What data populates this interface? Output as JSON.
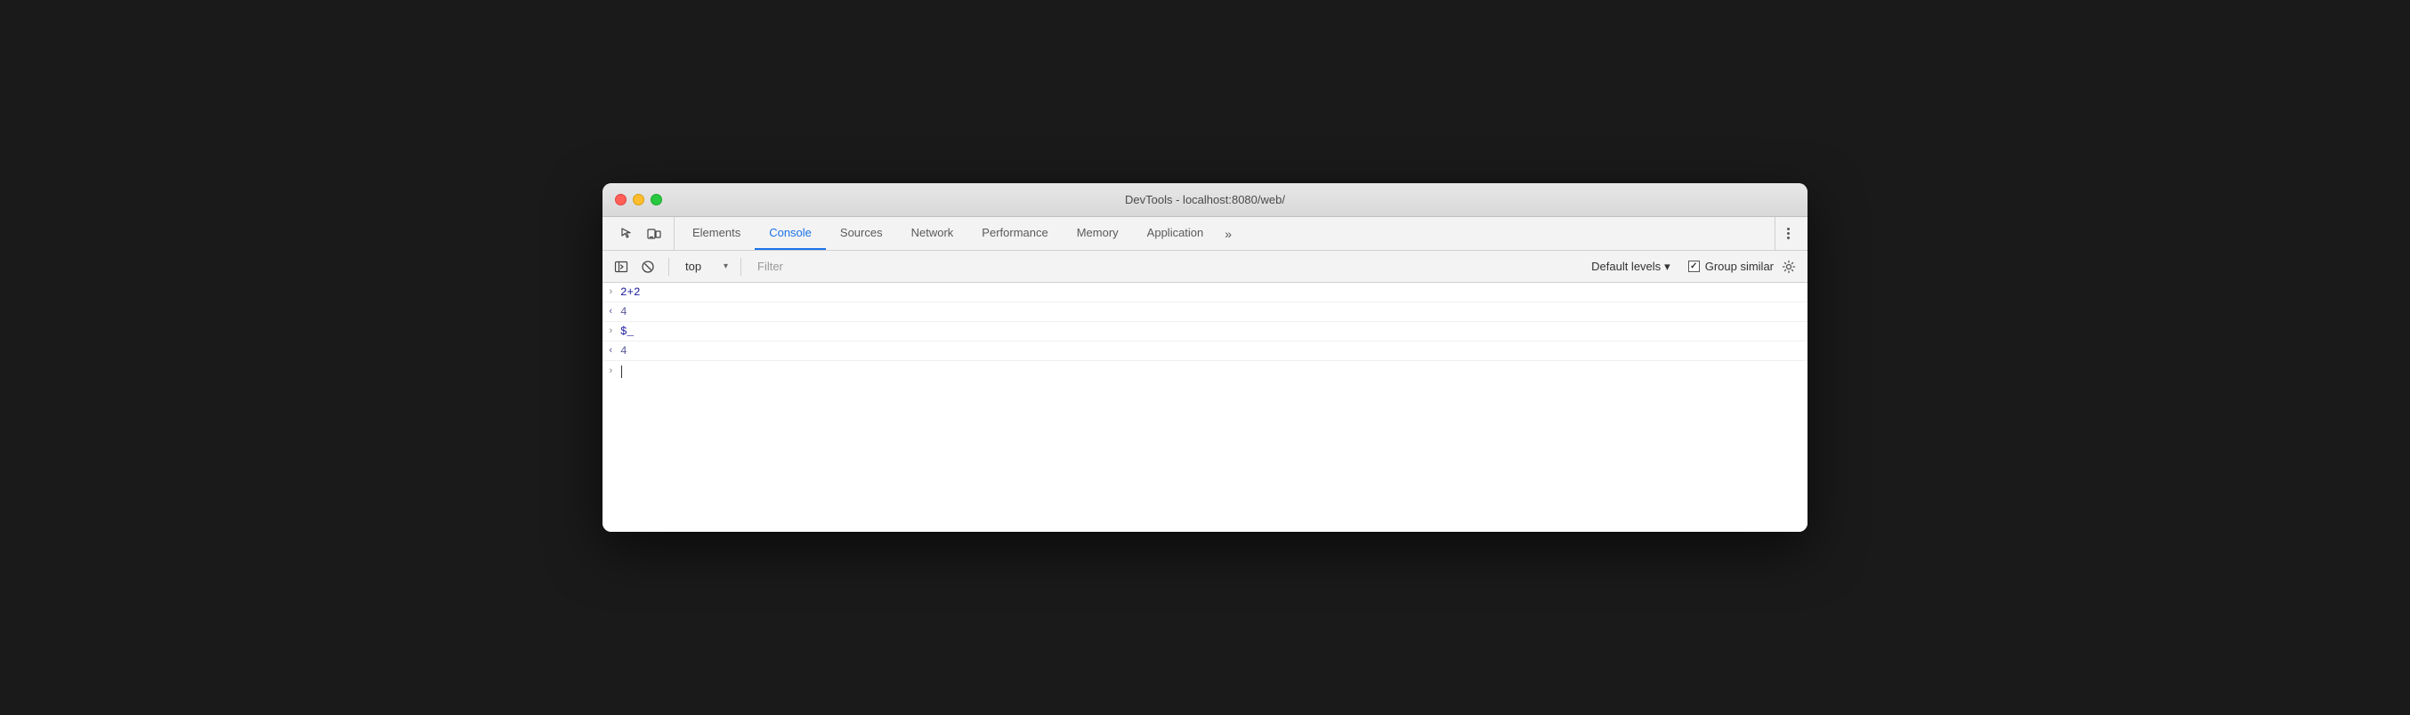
{
  "window": {
    "title": "DevTools - localhost:8080/web/"
  },
  "toolbar": {
    "elements_label": "Elements",
    "console_label": "Console",
    "sources_label": "Sources",
    "network_label": "Network",
    "performance_label": "Performance",
    "memory_label": "Memory",
    "application_label": "Application",
    "overflow_label": "»"
  },
  "console_toolbar": {
    "context_value": "top",
    "context_placeholder": "top",
    "filter_placeholder": "Filter",
    "default_levels_label": "Default levels",
    "group_similar_label": "Group similar"
  },
  "console_rows": [
    {
      "chevron": ">",
      "type": "input",
      "text": "2+2"
    },
    {
      "chevron": "<",
      "type": "output",
      "text": "4"
    },
    {
      "chevron": ">",
      "type": "input",
      "text": "$_"
    },
    {
      "chevron": "<",
      "type": "output",
      "text": "4"
    }
  ],
  "icons": {
    "inspector": "inspector-icon",
    "device_toolbar": "device-toolbar-icon",
    "clear_console": "clear-console-icon",
    "settings_gear": "⚙",
    "chevron_down": "▾"
  }
}
